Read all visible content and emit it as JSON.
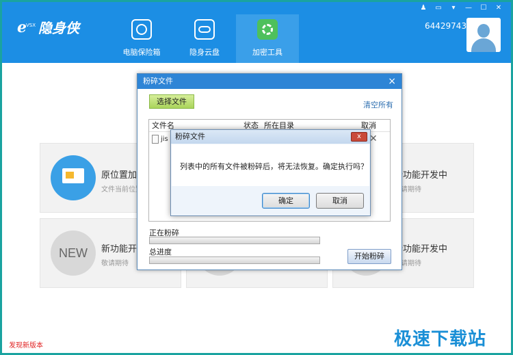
{
  "header": {
    "logo": {
      "mark": "e",
      "sub": "VSX",
      "name": "隐身侠"
    },
    "nav": [
      {
        "label": "电脑保险箱",
        "icon": "safe-icon",
        "active": false
      },
      {
        "label": "隐身云盘",
        "icon": "cloud-icon",
        "active": false
      },
      {
        "label": "加密工具",
        "icon": "gear-tool-icon",
        "active": true
      }
    ],
    "user_id": "64429743",
    "window_controls": [
      "shirt-icon",
      "message-icon",
      "menu-icon",
      "minimize-icon",
      "maximize-icon",
      "close-icon"
    ]
  },
  "cards": [
    {
      "title": "原位置加密",
      "desc": "文件当前位置"
    },
    {
      "title": "新功能开发中",
      "desc": "敬请期待"
    },
    {
      "title": "新功能开发中",
      "desc": "敬请期待"
    },
    {
      "title": "新功能开发中",
      "desc": "敬请期待",
      "badge": "NEW"
    },
    {
      "title": "新功能开发中",
      "desc": "敬请期待"
    }
  ],
  "status_link": "发现新版本",
  "watermark": "极速下载站",
  "shred_dialog": {
    "title": "粉碎文件",
    "close": "×",
    "select_button": "选择文件",
    "clear_link": "清空所有",
    "columns": {
      "name": "文件名",
      "status": "状态",
      "dir": "所在目录",
      "cancel": "取消"
    },
    "row": {
      "name": "jis"
    },
    "progress_current_label": "正在粉碎",
    "progress_total_label": "总进度",
    "progress_current": 0,
    "progress_total": 0,
    "start_button": "开始粉碎"
  },
  "confirm_dialog": {
    "title": "粉碎文件",
    "close": "x",
    "message": "列表中的所有文件被粉碎后，将无法恢复。确定执行吗？",
    "ok": "确定",
    "cancel": "取消"
  },
  "colors": {
    "header": "#1c8ee4",
    "accent": "#2e85d6",
    "green": "#4ec05c",
    "frame": "#1aa3a0"
  }
}
